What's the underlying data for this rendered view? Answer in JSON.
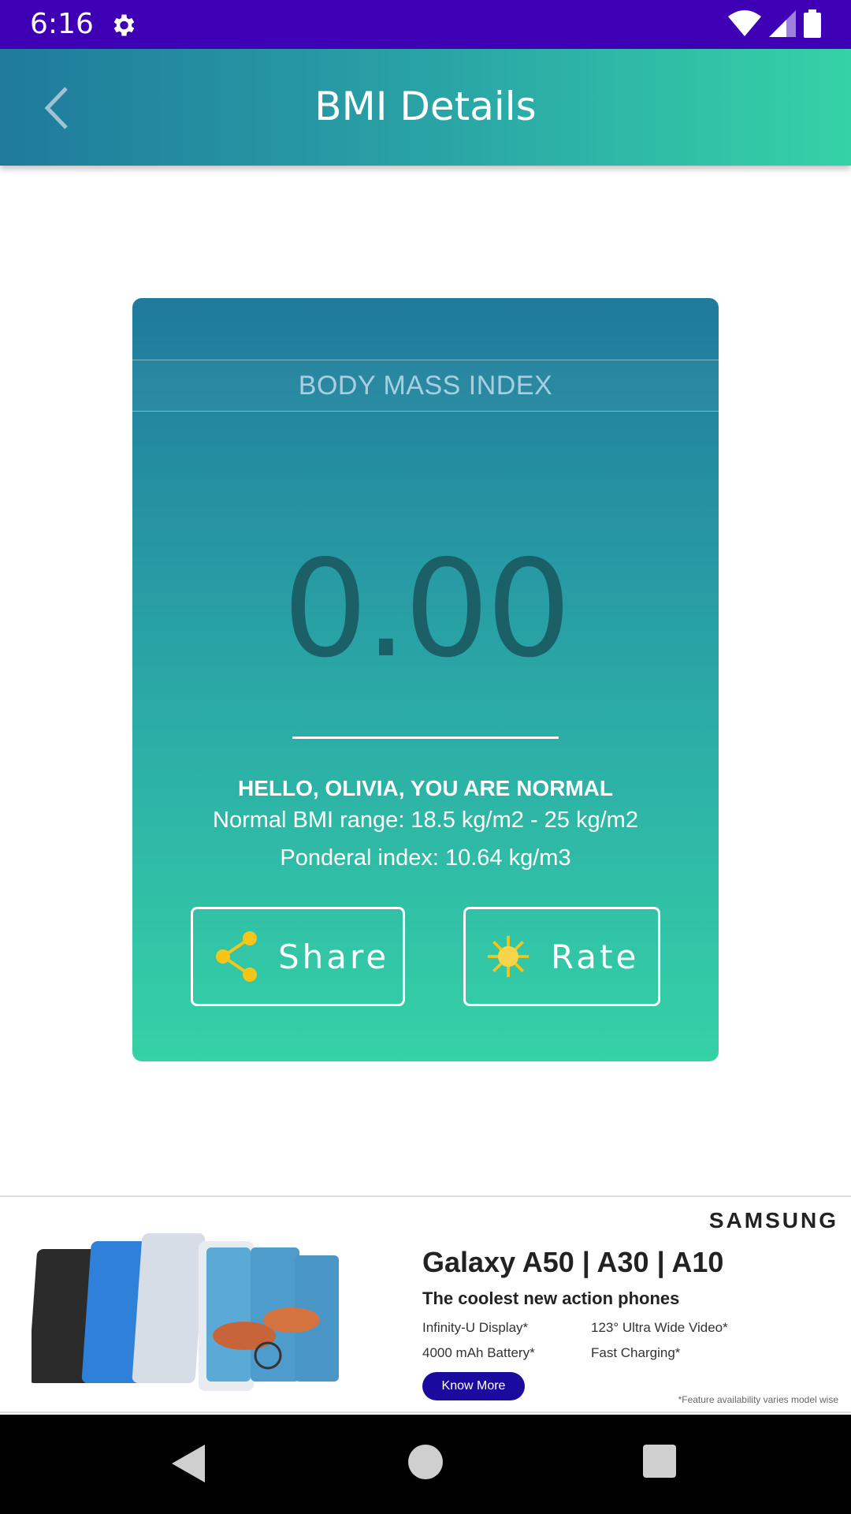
{
  "status_bar": {
    "time": "6:16"
  },
  "app_bar": {
    "title": "BMI Details"
  },
  "card": {
    "header": "BODY MASS INDEX",
    "bmi_value": "0.00",
    "status_message": "HELLO, OLIVIA, YOU ARE NORMAL",
    "normal_range": "Normal BMI range: 18.5 kg/m2 - 25 kg/m2",
    "ponderal_index": "Ponderal index: 10.64 kg/m3",
    "share_label": "Share",
    "rate_label": "Rate"
  },
  "ad": {
    "brand": "SAMSUNG",
    "models": "Galaxy A50 | A30 | A10",
    "tagline": "The coolest new action phones",
    "features": [
      "Infinity-U Display*",
      "123° Ultra Wide Video*",
      "4000 mAh Battery*",
      "Fast Charging*"
    ],
    "cta": "Know More",
    "disclaimer": "*Feature availability varies model wise"
  },
  "colors": {
    "status_bar": "#3f00b5",
    "gradient_start": "#1f7a9c",
    "gradient_end": "#35d2a6",
    "bmi_value": "#1b5f67",
    "share_icon": "#f5c518",
    "cta": "#1b0a9e"
  },
  "icons": [
    "gear-icon",
    "wifi-icon",
    "signal-icon",
    "battery-icon",
    "back-arrow-icon",
    "share-icon",
    "sun-icon",
    "nav-back-icon",
    "nav-home-icon",
    "nav-recent-icon"
  ]
}
